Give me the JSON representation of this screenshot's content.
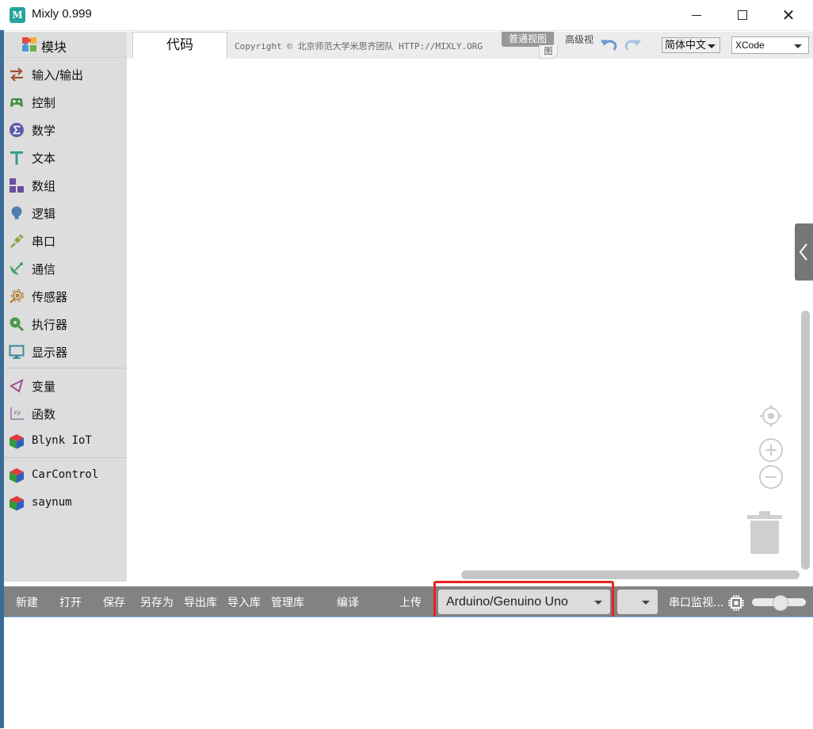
{
  "window": {
    "title": "Mixly 0.999",
    "icon_letter": "M",
    "buttons": [
      "minimize-icon",
      "maximize-icon",
      "close-icon"
    ]
  },
  "sidebar": {
    "header": "模块",
    "groups": [
      [
        {
          "label": "输入/输出",
          "icon": "arrows-icon",
          "color": "#a0522d"
        },
        {
          "label": "控制",
          "icon": "gamepad-icon",
          "color": "#4a8f4a"
        },
        {
          "label": "数学",
          "icon": "sigma-icon",
          "color": "#5c5ca8"
        },
        {
          "label": "文本",
          "icon": "text-T-icon",
          "color": "#3a9a8a"
        },
        {
          "label": "数组",
          "icon": "blocks-icon",
          "color": "#6b4f9e"
        },
        {
          "label": "逻辑",
          "icon": "bulb-icon",
          "color": "#4f7fb0"
        },
        {
          "label": "串口",
          "icon": "plug-icon",
          "color": "#8aa03a"
        },
        {
          "label": "通信",
          "icon": "satellite-icon",
          "color": "#4aa06b"
        },
        {
          "label": "传感器",
          "icon": "sensor-icon",
          "color": "#b07a30"
        },
        {
          "label": "执行器",
          "icon": "actuator-icon",
          "color": "#4a9a4a"
        },
        {
          "label": "显示器",
          "icon": "monitor-icon",
          "color": "#3a8a9a"
        }
      ],
      [
        {
          "label": "变量",
          "icon": "variable-icon",
          "color": "#a0508a"
        },
        {
          "label": "函数",
          "icon": "function-icon",
          "color": "#8a5a9a"
        },
        {
          "label": "Blynk IoT",
          "icon": "cube-icon",
          "color": "#2a8a2a"
        }
      ],
      [
        {
          "label": "CarControl",
          "icon": "cube-icon",
          "color": "#2a8a2a"
        },
        {
          "label": "saynum",
          "icon": "cube-icon",
          "color": "#2a8a2a"
        }
      ]
    ]
  },
  "topbar": {
    "code_tab": "代码",
    "copyright": "Copyright © 北京师范大学米思齐团队 HTTP://MIXLY.ORG",
    "view_normal": "普通视图",
    "view_normal_tail": "图",
    "view_advanced": "高级视",
    "language": "简体中文",
    "theme": "XCode"
  },
  "toolbar": {
    "buttons": [
      "新建",
      "打开",
      "保存",
      "另存为",
      "导出库",
      "导入库",
      "管理库",
      "编译",
      "上传"
    ],
    "board": "Arduino/Genuino Uno",
    "port": "",
    "serial_monitor": "串口监视..."
  },
  "colors": {
    "toolbar_bg": "#828282",
    "sidebar_bg": "#dddddd",
    "highlight": "#e8231f",
    "frame": "#3c6b98"
  }
}
